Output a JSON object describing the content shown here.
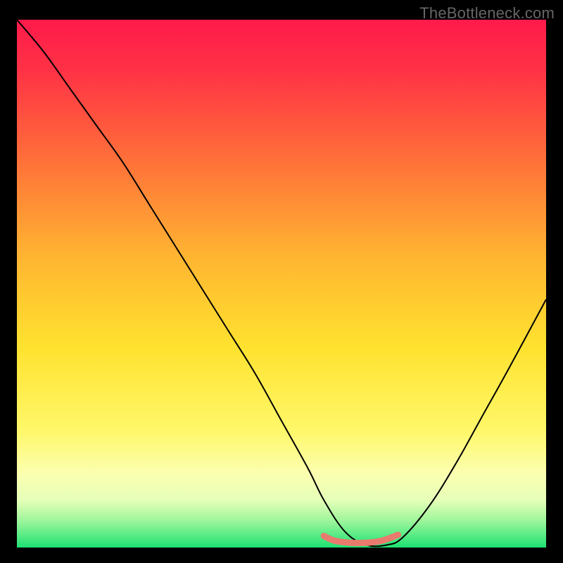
{
  "watermark": "TheBottleneck.com",
  "chart_data": {
    "type": "line",
    "title": "",
    "xlabel": "",
    "ylabel": "",
    "xlim": [
      0,
      100
    ],
    "ylim": [
      0,
      100
    ],
    "grid": false,
    "legend": false,
    "annotations": [],
    "background_gradient_stops": [
      {
        "offset": 0.0,
        "color": "#ff1a4b"
      },
      {
        "offset": 0.1,
        "color": "#ff3345"
      },
      {
        "offset": 0.25,
        "color": "#ff6a3a"
      },
      {
        "offset": 0.45,
        "color": "#ffb531"
      },
      {
        "offset": 0.62,
        "color": "#ffe22f"
      },
      {
        "offset": 0.78,
        "color": "#fff86a"
      },
      {
        "offset": 0.86,
        "color": "#fbffb0"
      },
      {
        "offset": 0.91,
        "color": "#e6ffb8"
      },
      {
        "offset": 0.95,
        "color": "#9cf59a"
      },
      {
        "offset": 1.0,
        "color": "#1de272"
      }
    ],
    "series": [
      {
        "name": "bottleneck-curve",
        "stroke": "#000000",
        "stroke_width": 2,
        "x": [
          0,
          5,
          10,
          15,
          20,
          25,
          30,
          35,
          40,
          45,
          50,
          55,
          58,
          62,
          66,
          70,
          73,
          78,
          83,
          88,
          93,
          100
        ],
        "y": [
          100,
          94,
          87,
          80,
          73,
          65,
          57,
          49,
          41,
          33,
          24,
          15,
          9,
          3,
          0.5,
          0.5,
          2,
          8,
          16,
          25,
          34,
          47
        ]
      },
      {
        "name": "optimal-band",
        "stroke": "#e97a6e",
        "stroke_width": 9,
        "linecap": "round",
        "x": [
          58,
          60,
          63,
          66,
          69,
          72
        ],
        "y": [
          2.2,
          1.3,
          0.9,
          0.9,
          1.3,
          2.4
        ]
      }
    ]
  }
}
